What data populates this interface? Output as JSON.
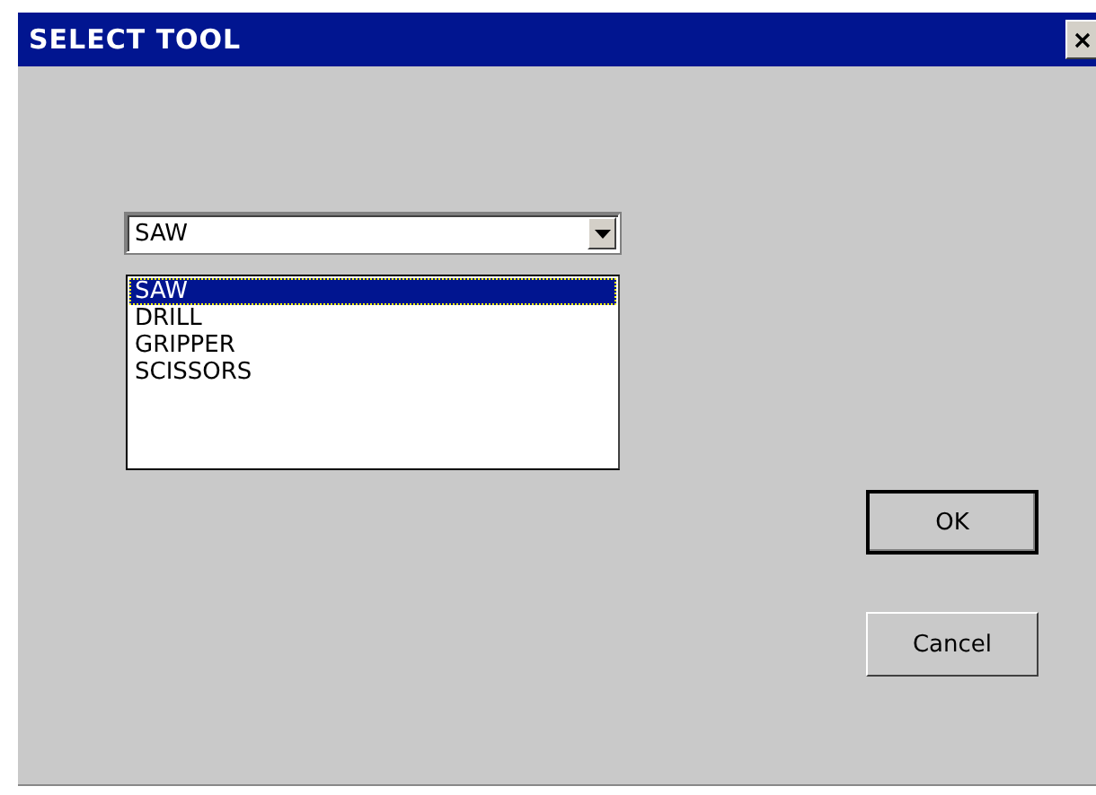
{
  "window": {
    "title": "SELECT TOOL"
  },
  "combo": {
    "value": "SAW",
    "expanded": true,
    "options": [
      {
        "label": "SAW",
        "selected": true
      },
      {
        "label": "DRILL",
        "selected": false
      },
      {
        "label": "GRIPPER",
        "selected": false
      },
      {
        "label": "SCISSORS",
        "selected": false
      }
    ]
  },
  "buttons": [
    {
      "label": "OK",
      "default": true
    },
    {
      "label": "Cancel",
      "default": false
    }
  ]
}
